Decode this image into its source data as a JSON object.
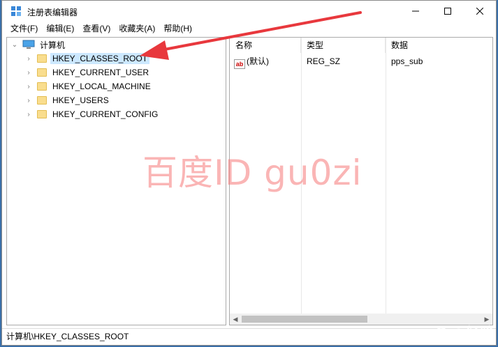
{
  "window": {
    "title": "注册表编辑器"
  },
  "menu": [
    "文件(F)",
    "编辑(E)",
    "查看(V)",
    "收藏夹(A)",
    "帮助(H)"
  ],
  "tree": {
    "root": "计算机",
    "items": [
      {
        "label": "HKEY_CLASSES_ROOT",
        "selected": true
      },
      {
        "label": "HKEY_CURRENT_USER",
        "selected": false
      },
      {
        "label": "HKEY_LOCAL_MACHINE",
        "selected": false
      },
      {
        "label": "HKEY_USERS",
        "selected": false
      },
      {
        "label": "HKEY_CURRENT_CONFIG",
        "selected": false
      }
    ]
  },
  "list": {
    "columns": [
      "名称",
      "类型",
      "数据"
    ],
    "rows": [
      {
        "name": "(默认)",
        "type": "REG_SZ",
        "data": "pps_sub",
        "icon": "ab-string-icon"
      }
    ]
  },
  "status": {
    "path": "计算机\\HKEY_CLASSES_ROOT"
  },
  "overlay": {
    "watermark": "百度ID gu0zi",
    "logo": "Bai 经验",
    "arrow_color": "#e8383d"
  }
}
